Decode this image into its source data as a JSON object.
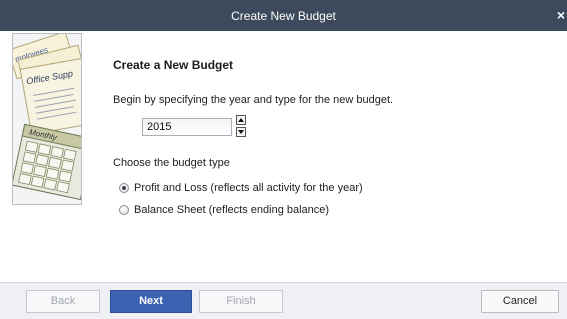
{
  "window": {
    "title": "Create New Budget",
    "close_glyph": "×"
  },
  "illustration": {
    "label_employees": "mployees",
    "label_computers": "Computers",
    "label_office": "Office Supp",
    "label_monthly": "Monthly"
  },
  "page": {
    "heading": "Create a New Budget",
    "intro": "Begin by specifying the year and type for the new budget.",
    "year_value": "2015",
    "choose_label": "Choose the budget type",
    "options": [
      {
        "label": "Profit and Loss (reflects all activity for the year)",
        "checked": true
      },
      {
        "label": "Balance Sheet (reflects ending balance)",
        "checked": false
      }
    ]
  },
  "buttons": {
    "back": "Back",
    "next": "Next",
    "finish": "Finish",
    "cancel": "Cancel"
  },
  "colors": {
    "titlebar": "#3d4a5c",
    "primary_button": "#3b63b2",
    "footer": "#eef0f3"
  }
}
